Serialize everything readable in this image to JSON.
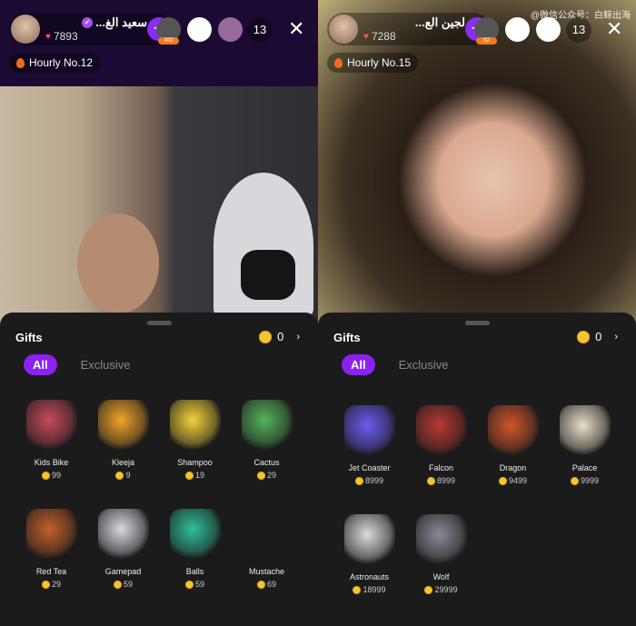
{
  "panels": [
    {
      "host": {
        "name": "سعيد الغ...",
        "likes": "7893",
        "verified": true
      },
      "viewer_badge": "400",
      "viewer_count": "13",
      "hourly": "Hourly No.12",
      "gifts": {
        "title": "Gifts",
        "balance": "0",
        "tabs": [
          "All",
          "Exclusive"
        ],
        "items": [
          {
            "name": "Kids Bike",
            "price": "99",
            "color": "#c84a5a"
          },
          {
            "name": "Kleeja",
            "price": "9",
            "color": "#f0a52a"
          },
          {
            "name": "Shampoo",
            "price": "19",
            "color": "#f3d23a"
          },
          {
            "name": "Cactus",
            "price": "29",
            "color": "#55b55a"
          },
          {
            "name": "Red Tea",
            "price": "29",
            "color": "#c2612a"
          },
          {
            "name": "Gamepad",
            "price": "59",
            "color": "#d8d8e0"
          },
          {
            "name": "Balls",
            "price": "59",
            "color": "#2fbf9a"
          },
          {
            "name": "Mustache",
            "price": "69",
            "color": "#555"
          }
        ]
      }
    },
    {
      "host": {
        "name": "لجين الع...",
        "likes": "7288",
        "verified": false
      },
      "viewer_badge": "62",
      "viewer_count": "13",
      "hourly": "Hourly No.15",
      "watermark": "@微信公众号：白鲸出海",
      "gifts": {
        "title": "Gifts",
        "balance": "0",
        "tabs": [
          "All",
          "Exclusive"
        ],
        "items": [
          {
            "name": "Jet Coaster",
            "price": "8999",
            "color": "#6a5cf0"
          },
          {
            "name": "Falcon",
            "price": "8999",
            "color": "#b83a30"
          },
          {
            "name": "Dragon",
            "price": "9499",
            "color": "#d0552a"
          },
          {
            "name": "Palace",
            "price": "9999",
            "color": "#e8e0c8"
          },
          {
            "name": "Astronauts",
            "price": "18999",
            "color": "#dcdcdc"
          },
          {
            "name": "Wolf",
            "price": "29999",
            "color": "#8a8a95"
          }
        ]
      }
    }
  ]
}
